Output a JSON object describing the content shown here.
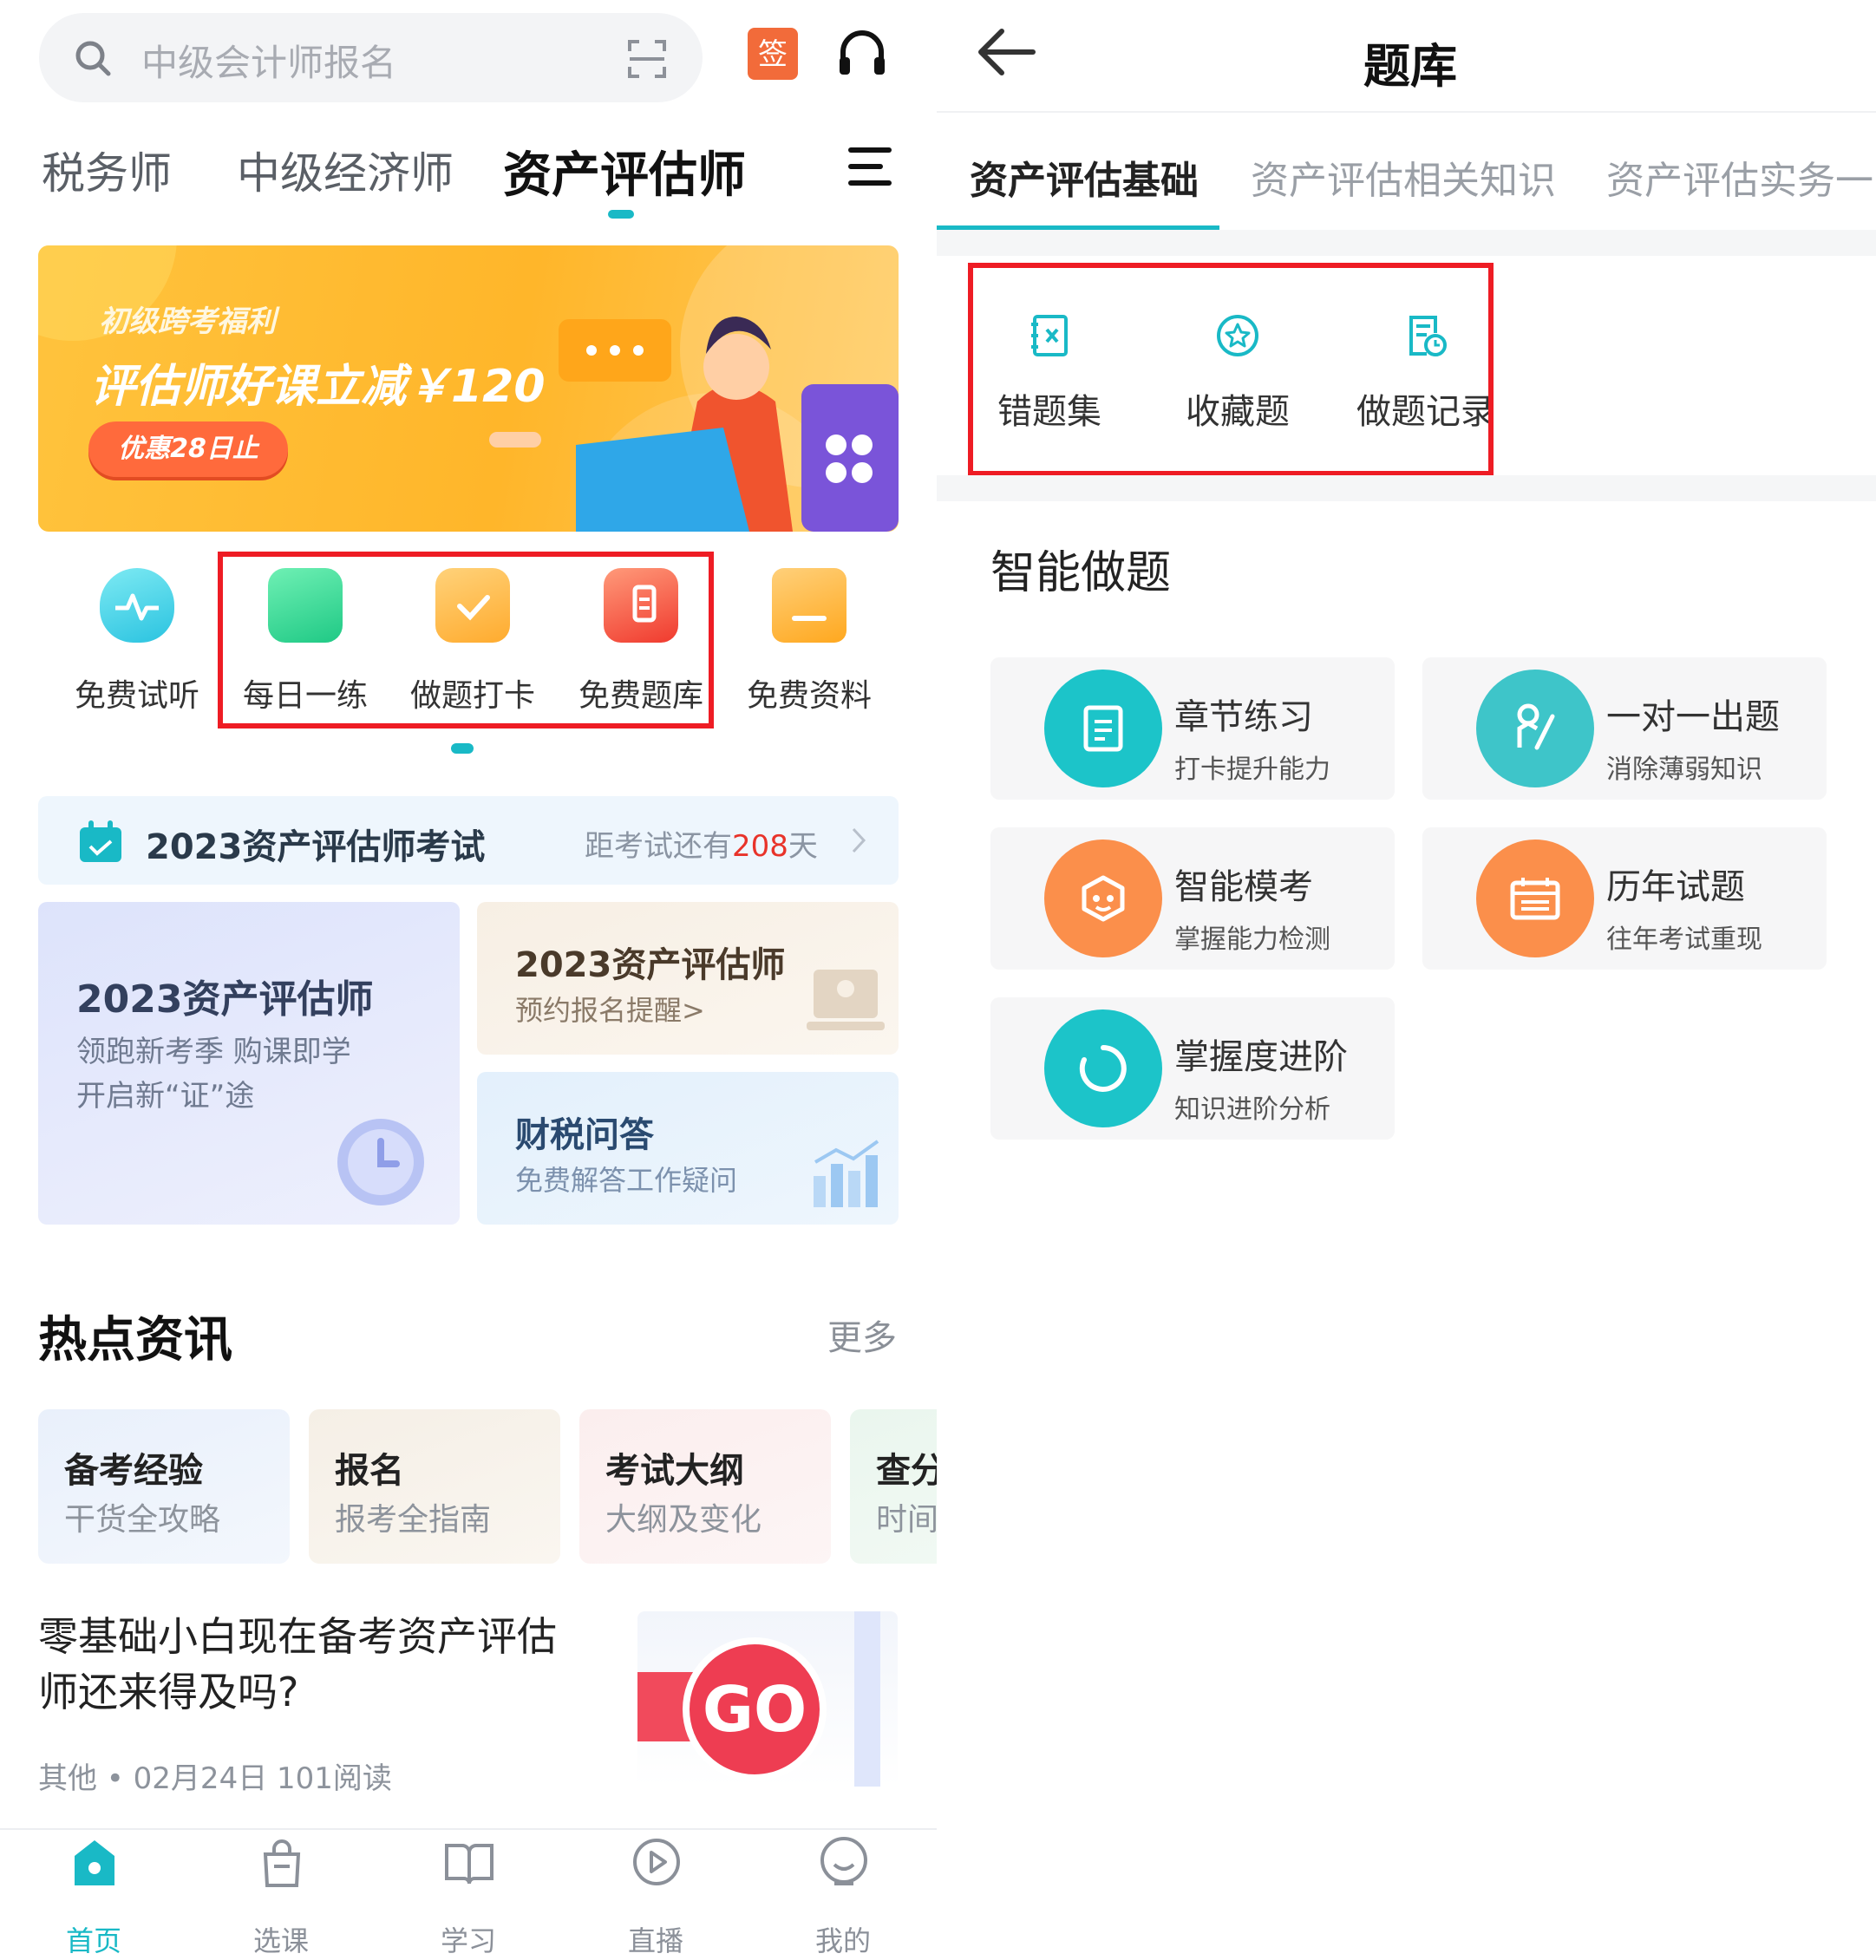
{
  "left": {
    "search": {
      "placeholder": "中级会计师报名"
    },
    "sign_label": "签",
    "tabs": [
      "税务师",
      "中级经济师",
      "资产评估师"
    ],
    "banner": {
      "line1": "初级跨考福利",
      "line2": "评估师好课立减￥120",
      "pill": "优惠28日止"
    },
    "quick": [
      "免费试听",
      "每日一练",
      "做题打卡",
      "免费题库",
      "免费资料"
    ],
    "exam": {
      "title": "2023资产评估师考试",
      "countdown_prefix": "距考试还有",
      "days": "208",
      "days_suffix": "天"
    },
    "card_main": {
      "title": "2023资产评估师",
      "line1": "领跑新考季 购课即学",
      "line2": "开启新“证”途"
    },
    "card_reg": {
      "title": "2023资产评估师",
      "sub": "预约报名提醒>"
    },
    "card_tax": {
      "title": "财税问答",
      "sub": "免费解答工作疑问"
    },
    "hot": {
      "title": "热点资讯",
      "more": "更多"
    },
    "chips": [
      {
        "a": "备考经验",
        "b": "干货全攻略"
      },
      {
        "a": "报名",
        "b": "报考全指南"
      },
      {
        "a": "考试大纲",
        "b": "大纲及变化"
      },
      {
        "a": "查分",
        "b": "时间"
      }
    ],
    "article": {
      "title_line1": "零基础小白现在备考资产评估",
      "title_line2": "师还来得及吗?",
      "meta": "其他 • 02月24日  101阅读",
      "thumb_text": "GO"
    },
    "nav": [
      "首页",
      "选课",
      "学习",
      "直播",
      "我的"
    ]
  },
  "right": {
    "title": "题库",
    "tabs": [
      "资产评估基础",
      "资产评估相关知识",
      "资产评估实务一"
    ],
    "tools": [
      "错题集",
      "收藏题",
      "做题记录"
    ],
    "section": "智能做题",
    "cards": [
      {
        "title": "章节练习",
        "desc": "打卡提升能力"
      },
      {
        "title": "一对一出题",
        "desc": "消除薄弱知识"
      },
      {
        "title": "智能模考",
        "desc": "掌握能力检测"
      },
      {
        "title": "历年试题",
        "desc": "往年考试重现"
      },
      {
        "title": "掌握度进阶",
        "desc": "知识进阶分析"
      }
    ]
  },
  "colors": {
    "accent": "#19b9c6",
    "highlight": "#ee1c24",
    "orange": "#fb8f4b",
    "countdown": "#e8332a"
  }
}
